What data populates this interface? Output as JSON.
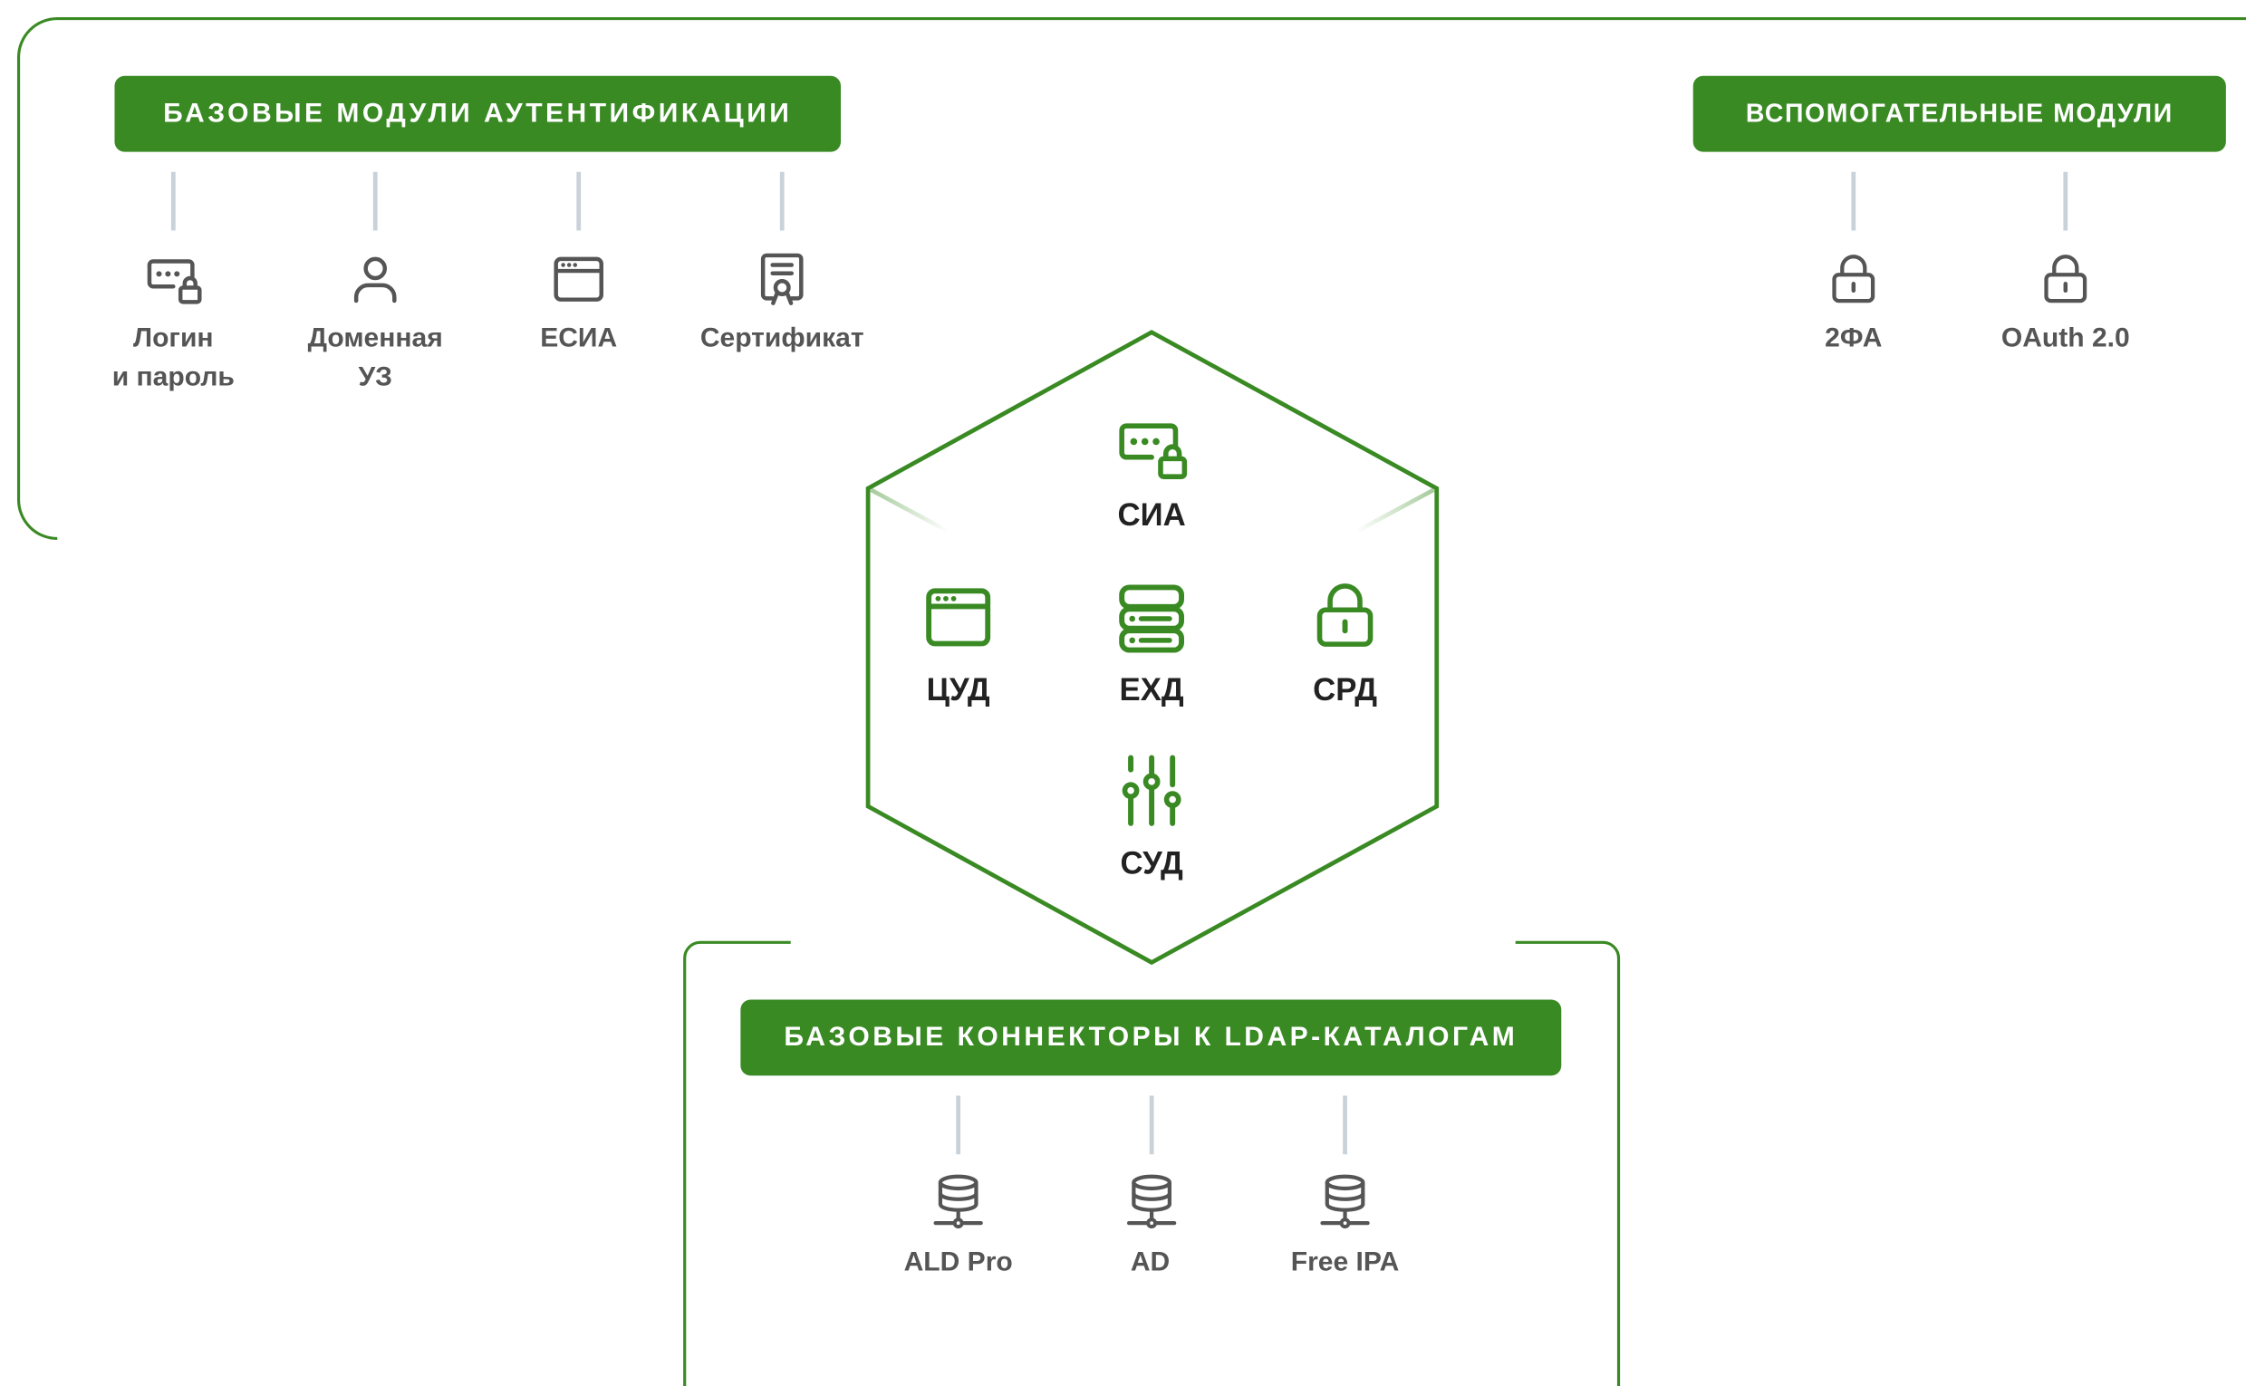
{
  "palette": {
    "accent": "#3a8a24",
    "icon_gray": "#555555",
    "connector_gray": "#c9d1d9",
    "text_dark": "#222222"
  },
  "auth_modules": {
    "title": "БАЗОВЫЕ МОДУЛИ АУТЕНТИФИКАЦИИ",
    "items": [
      {
        "icon": "login-password-icon",
        "line1": "Логин",
        "line2": "и пароль"
      },
      {
        "icon": "user-icon",
        "line1": "Доменная",
        "line2": "УЗ"
      },
      {
        "icon": "browser-window-icon",
        "line1": "ЕСИА",
        "line2": ""
      },
      {
        "icon": "certificate-icon",
        "line1": "Сертификат",
        "line2": ""
      }
    ]
  },
  "aux_modules": {
    "title": "ВСПОМОГАТЕЛЬНЫЕ МОДУЛИ",
    "items": [
      {
        "icon": "lock-icon",
        "line1": "2ФА"
      },
      {
        "icon": "lock-icon",
        "line1": "OAuth 2.0"
      }
    ]
  },
  "core": {
    "items": [
      {
        "icon": "login-password-icon",
        "label": "СИА"
      },
      {
        "icon": "browser-window-icon",
        "label": "ЦУД"
      },
      {
        "icon": "server-storage-icon",
        "label": "ЕХД"
      },
      {
        "icon": "lock-icon",
        "label": "СРД"
      },
      {
        "icon": "sliders-icon",
        "label": "СУД"
      }
    ]
  },
  "ldap_connectors": {
    "title": "БАЗОВЫЕ КОННЕКТОРЫ К LDAP-КАТАЛОГАМ",
    "items": [
      {
        "icon": "database-network-icon",
        "label": "ALD Pro"
      },
      {
        "icon": "database-network-icon",
        "label": "AD"
      },
      {
        "icon": "database-network-icon",
        "label": "Free IPA"
      }
    ]
  }
}
